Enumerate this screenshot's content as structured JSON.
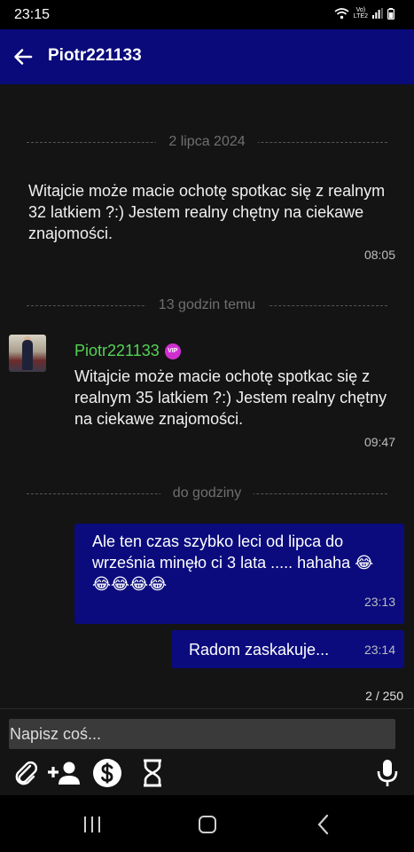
{
  "status_bar": {
    "time": "23:15",
    "lte_label_top": "Vo)",
    "lte_label_bottom": "LTE2"
  },
  "header": {
    "title": "Piotr221133"
  },
  "dividers": [
    "2 lipca 2024",
    "13 godzin temu",
    "do godziny"
  ],
  "messages": [
    {
      "text": "Witajcie może macie ochotę spotkac się z realnym 32 latkiem ?:) Jestem realny chętny na ciekawe znajomości.",
      "time": "08:05"
    },
    {
      "sender": "Piotr221133",
      "badge": "VIP",
      "text": "Witajcie może macie ochotę spotkac się z realnym 35 latkiem ?:) Jestem realny chętny na ciekawe znajomości.",
      "time": "09:47"
    },
    {
      "text": "Ale ten czas szybko leci od lipca do września minęło ci 3 lata ..... hahaha 😂😂😂😂😂",
      "time": "23:13"
    },
    {
      "text": "Radom zaskakuje...",
      "time": "23:14"
    }
  ],
  "char_counter": "2 / 250",
  "composer": {
    "placeholder": "Napisz coś..."
  },
  "colors": {
    "header": "#0a0a7a",
    "bubble": "#0b0b7e",
    "sender": "#55d255",
    "vip": "#d02fd0"
  }
}
